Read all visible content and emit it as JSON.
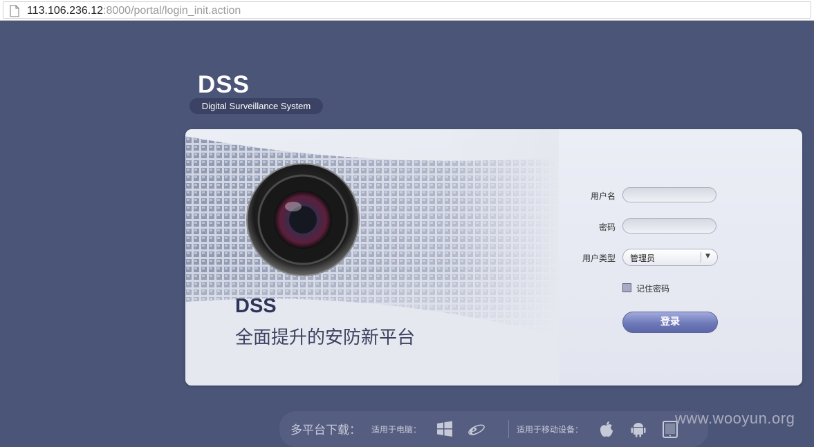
{
  "browser": {
    "url_host": "113.106.236.12",
    "url_rest": ":8000/portal/login_init.action"
  },
  "logo": {
    "title": "DSS",
    "subtitle": "Digital Surveillance System"
  },
  "hero": {
    "title": "DSS",
    "subtitle": "全面提升的安防新平台"
  },
  "form": {
    "username_label": "用户名",
    "username_value": "",
    "password_label": "密码",
    "password_value": "",
    "user_type_label": "用户类型",
    "user_type_value": "管理员",
    "remember_label": "记住密码",
    "remember_checked": false,
    "login_label": "登录"
  },
  "footer": {
    "title": "多平台下载：",
    "pc_label": "适用于电脑：",
    "mobile_label": "适用于移动设备：",
    "pc_icons": [
      "windows-icon",
      "ie-icon"
    ],
    "mobile_icons": [
      "apple-icon",
      "android-icon",
      "tablet-icon"
    ]
  },
  "watermark": "www.wooyun.org",
  "colors": {
    "background": "#4b5578",
    "panel": "#e6e8f0",
    "accent": "#6e79b9"
  }
}
